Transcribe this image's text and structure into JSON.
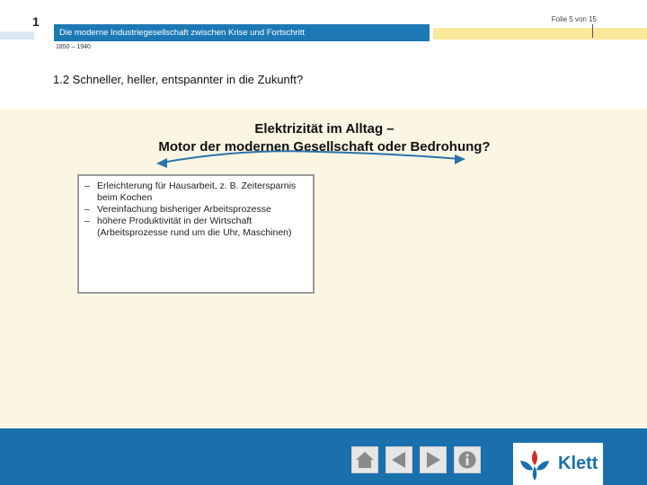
{
  "header": {
    "chapter_number": "1",
    "title": "Die moderne Industriegesellschaft zwischen Krise und Fortschritt",
    "date_range": "1850 – 1940",
    "slide_counter": "Folie 5 von 15"
  },
  "subtitle": "1.2  Schneller, heller, entspannter in die Zukunft?",
  "question": {
    "line1": "Elektrizität im Alltag –",
    "line2": "Motor der modernen Gesellschaft oder Bedrohung?"
  },
  "answers": [
    "Erleichterung für Hausarbeit, z. B. Zeitersparnis beim Kochen",
    "Vereinfachung bisheriger Arbeitsprozesse",
    "höhere Produktivität in der Wirtschaft (Arbeitsprozesse rund um die Uhr, Maschinen)"
  ],
  "footer": {
    "brand": "Klett",
    "icons": [
      "home-icon",
      "back-arrow-icon",
      "forward-arrow-icon",
      "info-icon"
    ]
  },
  "colors": {
    "header_blue": "#1d79b5",
    "footer_blue": "#1a70ad",
    "accent_yellow": "#fbe89b",
    "content_bg": "#fbf6e4",
    "klett_red": "#d62828"
  }
}
